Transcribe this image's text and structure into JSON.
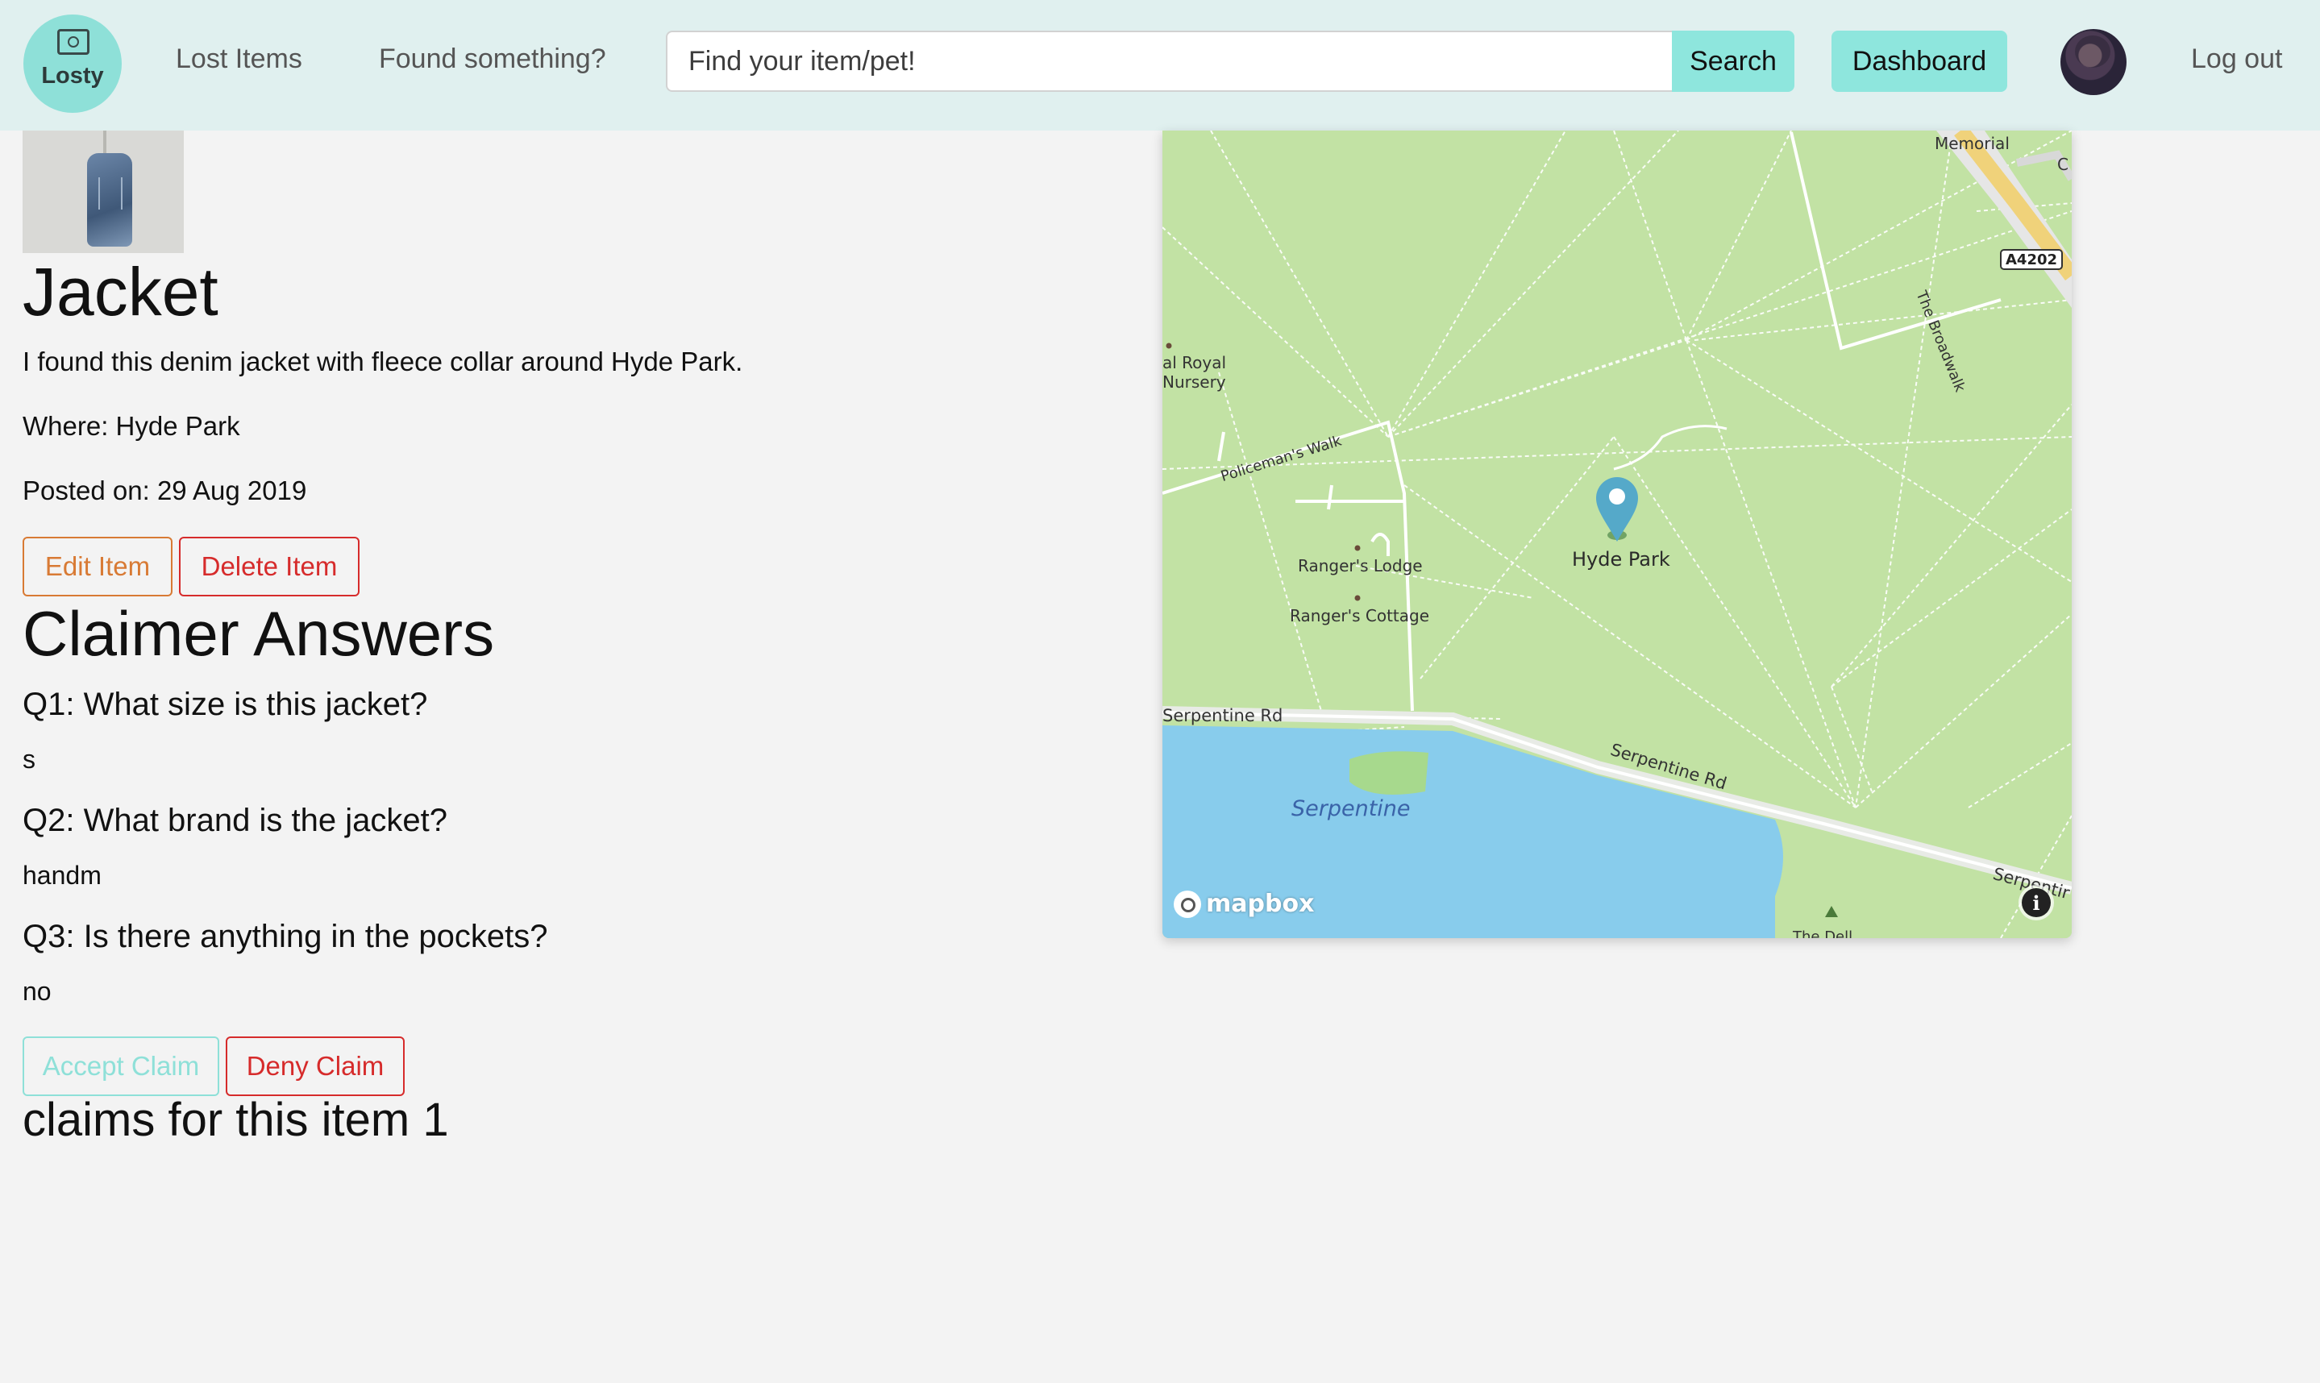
{
  "navbar": {
    "logo_text": "Losty",
    "links": [
      "Lost Items",
      "Found something?"
    ],
    "search_placeholder": "Find your item/pet!",
    "search_button": "Search",
    "dashboard_button": "Dashboard",
    "logout": "Log out"
  },
  "item": {
    "title": "Jacket",
    "description": "I found this denim jacket with fleece collar around Hyde Park.",
    "where": "Where: Hyde Park",
    "posted": "Posted on: 29 Aug 2019",
    "edit_button": "Edit Item",
    "delete_button": "Delete Item"
  },
  "claimer": {
    "heading": "Claimer Answers",
    "qa": [
      {
        "question": "Q1: What size is this jacket?",
        "answer": "s"
      },
      {
        "question": "Q2: What brand is the jacket?",
        "answer": "handm"
      },
      {
        "question": "Q3: Is there anything in the pockets?",
        "answer": "no"
      }
    ],
    "accept_button": "Accept Claim",
    "deny_button": "Deny Claim",
    "claims_count": "claims for this item 1"
  },
  "map": {
    "labels": {
      "memorial": "Memorial",
      "c": "C",
      "road_a4202": "A4202",
      "broadwalk": "The Broadwalk",
      "nursery_1": "al Royal",
      "nursery_2": "Nursery",
      "policemans_walk": "Policeman's Walk",
      "rangers_lodge": "Ranger's Lodge",
      "rangers_cottage": "Ranger's Cottage",
      "hyde_park": "Hyde Park",
      "serpentine_rd_left": "Serpentine Rd",
      "serpentine_rd_mid": "Serpentine Rd",
      "serpentine_rd_right": "Serpentir",
      "serpentine": "Serpentine",
      "the_dell": "The Dell"
    },
    "attribution": "mapbox",
    "colors": {
      "park": "#c2e2a4",
      "water": "#88ccec",
      "marker": "#55a9c9",
      "road": "#f0d27a"
    }
  }
}
